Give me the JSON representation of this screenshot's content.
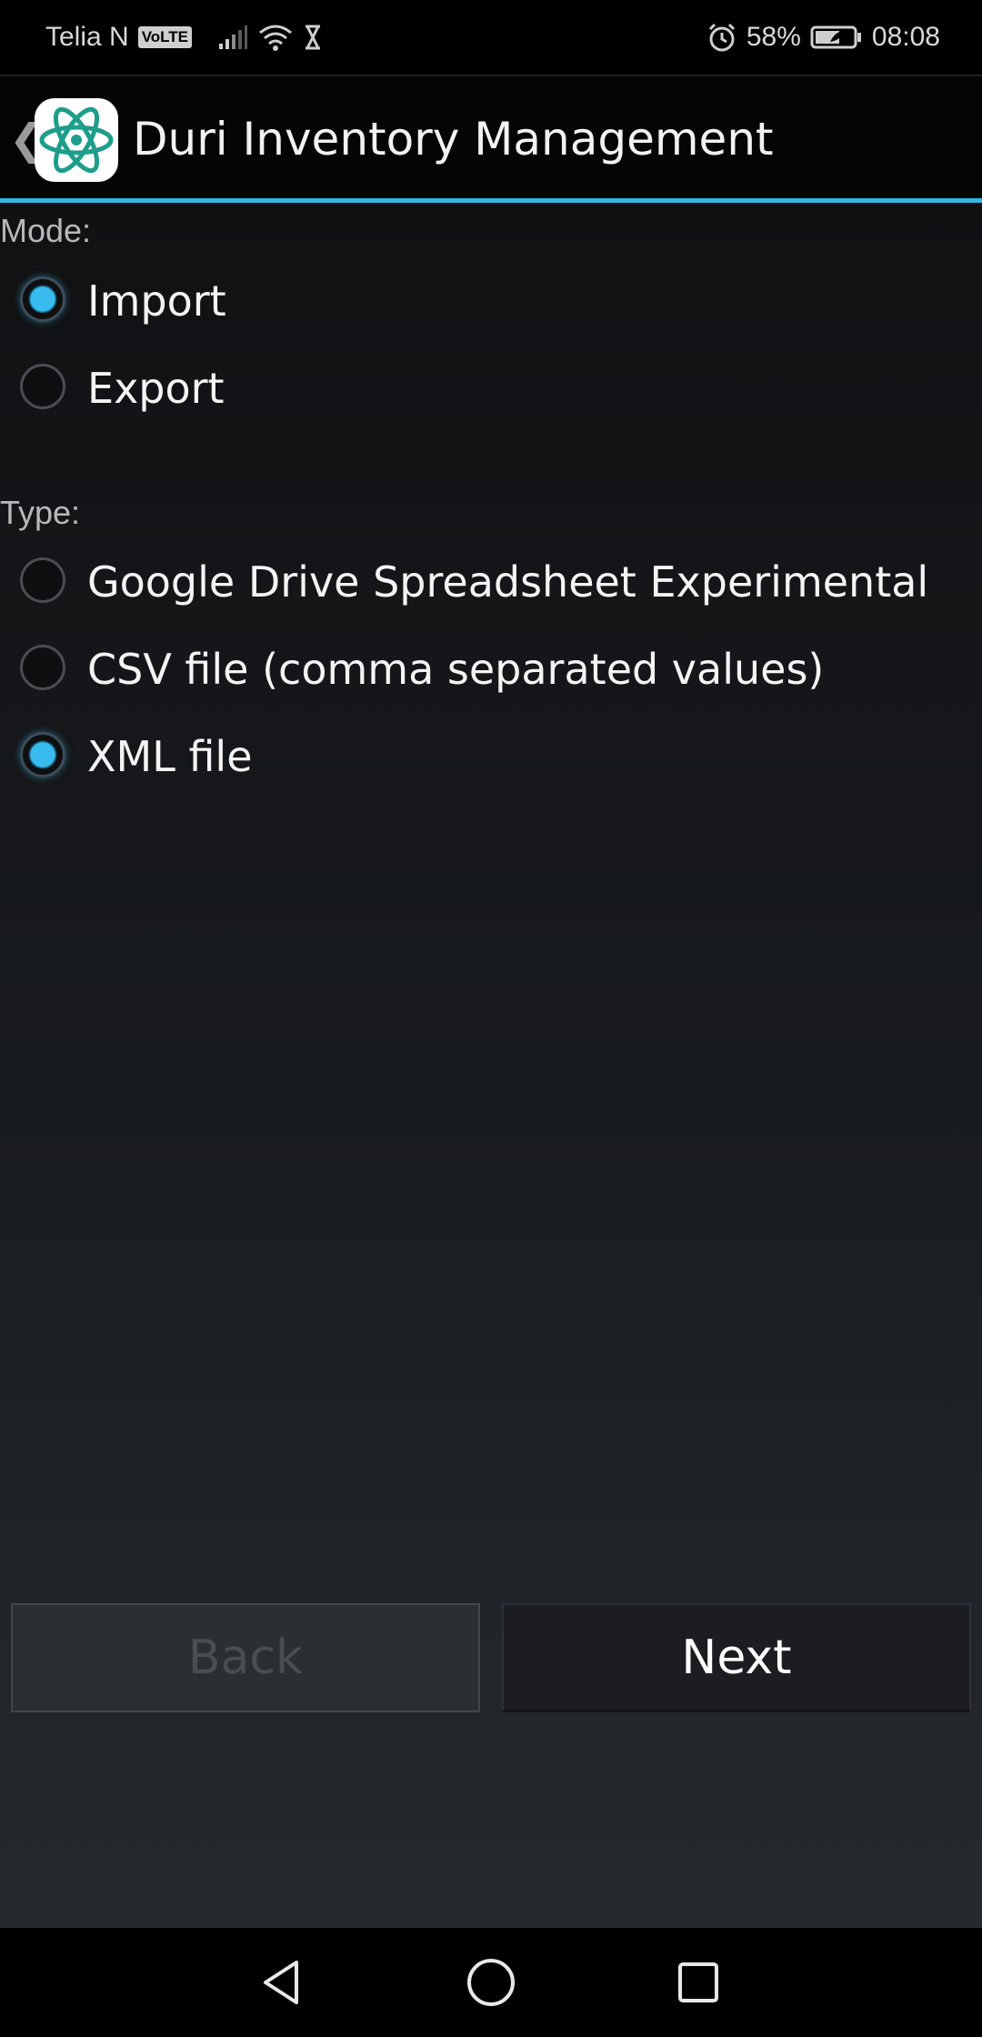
{
  "status_bar": {
    "carrier": "Telia N",
    "volte": "VoLTE",
    "battery_percent": "58%",
    "time": "08:08",
    "icons": [
      "signal-icon",
      "wifi-icon",
      "hourglass-icon",
      "alarm-icon",
      "battery-icon"
    ]
  },
  "action_bar": {
    "title": "Duri Inventory Management",
    "back_glyph": "❮",
    "accent_color": "#33b5e5"
  },
  "mode": {
    "label": "Mode:",
    "options": [
      {
        "label": "Import",
        "checked": true
      },
      {
        "label": "Export",
        "checked": false
      }
    ]
  },
  "type": {
    "label": "Type:",
    "options": [
      {
        "label": "Google Drive Spreadsheet Experimental",
        "checked": false
      },
      {
        "label": "CSV file (comma separated values)",
        "checked": false
      },
      {
        "label": "XML file",
        "checked": true
      }
    ]
  },
  "buttons": {
    "back": "Back",
    "next": "Next"
  },
  "nav_bar": {
    "icons": [
      "nav-back-icon",
      "nav-home-icon",
      "nav-recents-icon"
    ]
  }
}
